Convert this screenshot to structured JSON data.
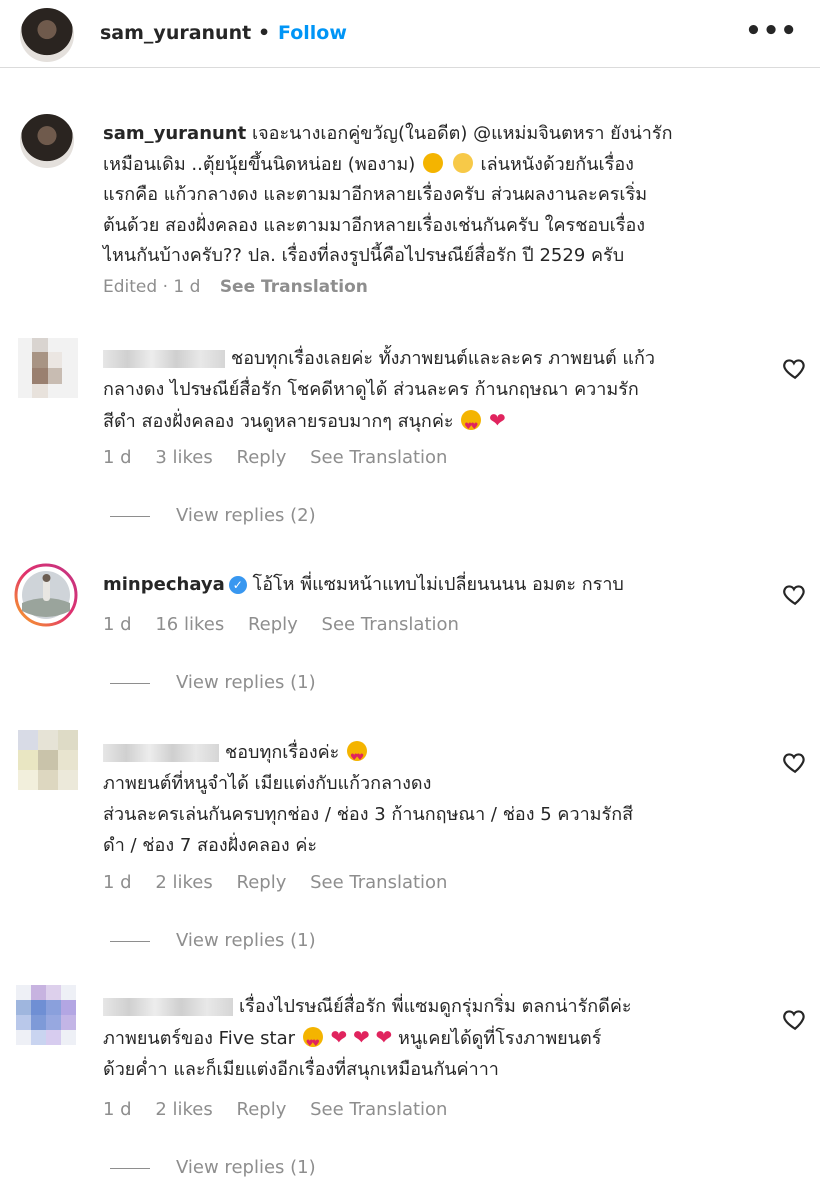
{
  "header": {
    "username": "sam_yuranunt",
    "separator": "•",
    "follow_label": "Follow",
    "more_label": "•••"
  },
  "caption": {
    "username": "sam_yuranunt",
    "lines": [
      "เจอะนางเอกคู่ขวัญ(ในอดีต) @แหม่มจินตหรา ยังน่ารัก",
      "เหมือนเดิม ..ตุ้ยนุ้ยขึ้นนิดหน่อย (พองาม)",
      "เล่นหนังด้วยกันเรื่อง",
      "แรกคือ แก้วกลางดง และตามมาอีกหลายเรื่องครับ ส่วนผลงานละครเริ่ม",
      "ต้นด้วย สองฝั่งคลอง และตามมาอีกหลายเรื่องเช่นกันครับ ใครชอบเรื่อง",
      "ไหนกันบ้างครับ?? ปล. เรื่องที่ลงรูปนี้คือไปรษณีย์สื่อรัก ปี 2529 ครับ"
    ],
    "edited": "Edited · 1 d",
    "see_translation": "See Translation"
  },
  "comments": [
    {
      "username": "",
      "lines": [
        "ชอบทุกเรื่องเลยค่ะ ทั้งภาพยนต์และละคร ภาพยนต์ แก้ว",
        "กลางดง ไปรษณีย์สื่อรัก โชคดีหาดูได้ ส่วนละคร ก้านกฤษณา ความรัก",
        "สีดำ สองฝั่งคลอง วนดูหลายรอบมากๆ สนุกค่ะ"
      ],
      "time": "1 d",
      "likes": "3 likes",
      "reply": "Reply",
      "see_translation": "See Translation",
      "view_replies": "View replies (2)"
    },
    {
      "username": "minpechaya",
      "verified_mark": "✓",
      "lines": [
        "โอ้โห พี่แซมหน้าแทบไม่เปลี่ยนนนน อมตะ กราบ"
      ],
      "time": "1 d",
      "likes": "16 likes",
      "reply": "Reply",
      "see_translation": "See Translation",
      "view_replies": "View replies (1)"
    },
    {
      "username": "",
      "lines": [
        "ชอบทุกเรื่องค่ะ",
        "ภาพยนต์ที่หนูจำได้ เมียแต่งกับแก้วกลางดง",
        "ส่วนละครเล่นกันครบทุกช่อง / ช่อง 3 ก้านกฤษณา / ช่อง 5 ความรักสี",
        "ดำ / ช่อง 7 สองฝั่งคลอง ค่ะ"
      ],
      "time": "1 d",
      "likes": "2 likes",
      "reply": "Reply",
      "see_translation": "See Translation",
      "view_replies": "View replies (1)"
    },
    {
      "username": "",
      "lines": [
        "เรื่องไปรษณีย์สื่อรัก พี่แซมดูกรุ่มกริ่ม ตลกน่ารักดีค่ะ",
        "ภาพยนตร์ของ Five star",
        "หนูเคยได้ดูที่โรงภาพยนตร์",
        "ด้วยค่ำา และก็เมียแต่งอีกเรื่องที่สนุกเหมือนกันค่าาา"
      ],
      "time": "1 d",
      "likes": "2 likes",
      "reply": "Reply",
      "see_translation": "See Translation",
      "view_replies": "View replies (1)"
    }
  ],
  "emoji": {
    "heart": "❤"
  },
  "colors": {
    "link": "#0095f6",
    "meta": "#8e8e8e",
    "text": "#262626",
    "heart": "#e0245e"
  }
}
